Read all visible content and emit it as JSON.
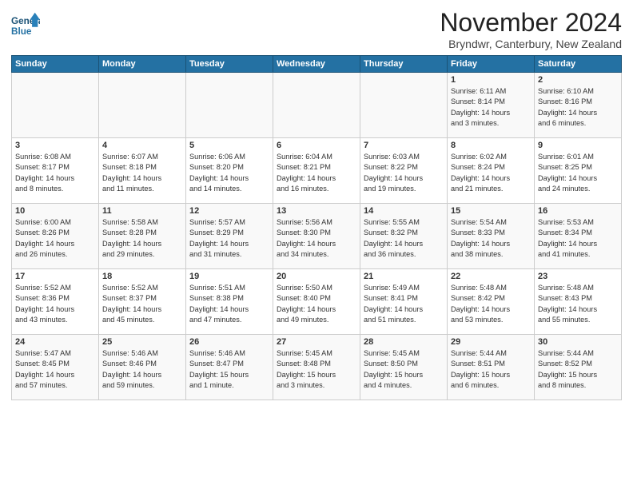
{
  "header": {
    "logo_line1": "General",
    "logo_line2": "Blue",
    "month": "November 2024",
    "location": "Bryndwr, Canterbury, New Zealand"
  },
  "weekdays": [
    "Sunday",
    "Monday",
    "Tuesday",
    "Wednesday",
    "Thursday",
    "Friday",
    "Saturday"
  ],
  "weeks": [
    [
      {
        "day": "",
        "info": ""
      },
      {
        "day": "",
        "info": ""
      },
      {
        "day": "",
        "info": ""
      },
      {
        "day": "",
        "info": ""
      },
      {
        "day": "",
        "info": ""
      },
      {
        "day": "1",
        "info": "Sunrise: 6:11 AM\nSunset: 8:14 PM\nDaylight: 14 hours\nand 3 minutes."
      },
      {
        "day": "2",
        "info": "Sunrise: 6:10 AM\nSunset: 8:16 PM\nDaylight: 14 hours\nand 6 minutes."
      }
    ],
    [
      {
        "day": "3",
        "info": "Sunrise: 6:08 AM\nSunset: 8:17 PM\nDaylight: 14 hours\nand 8 minutes."
      },
      {
        "day": "4",
        "info": "Sunrise: 6:07 AM\nSunset: 8:18 PM\nDaylight: 14 hours\nand 11 minutes."
      },
      {
        "day": "5",
        "info": "Sunrise: 6:06 AM\nSunset: 8:20 PM\nDaylight: 14 hours\nand 14 minutes."
      },
      {
        "day": "6",
        "info": "Sunrise: 6:04 AM\nSunset: 8:21 PM\nDaylight: 14 hours\nand 16 minutes."
      },
      {
        "day": "7",
        "info": "Sunrise: 6:03 AM\nSunset: 8:22 PM\nDaylight: 14 hours\nand 19 minutes."
      },
      {
        "day": "8",
        "info": "Sunrise: 6:02 AM\nSunset: 8:24 PM\nDaylight: 14 hours\nand 21 minutes."
      },
      {
        "day": "9",
        "info": "Sunrise: 6:01 AM\nSunset: 8:25 PM\nDaylight: 14 hours\nand 24 minutes."
      }
    ],
    [
      {
        "day": "10",
        "info": "Sunrise: 6:00 AM\nSunset: 8:26 PM\nDaylight: 14 hours\nand 26 minutes."
      },
      {
        "day": "11",
        "info": "Sunrise: 5:58 AM\nSunset: 8:28 PM\nDaylight: 14 hours\nand 29 minutes."
      },
      {
        "day": "12",
        "info": "Sunrise: 5:57 AM\nSunset: 8:29 PM\nDaylight: 14 hours\nand 31 minutes."
      },
      {
        "day": "13",
        "info": "Sunrise: 5:56 AM\nSunset: 8:30 PM\nDaylight: 14 hours\nand 34 minutes."
      },
      {
        "day": "14",
        "info": "Sunrise: 5:55 AM\nSunset: 8:32 PM\nDaylight: 14 hours\nand 36 minutes."
      },
      {
        "day": "15",
        "info": "Sunrise: 5:54 AM\nSunset: 8:33 PM\nDaylight: 14 hours\nand 38 minutes."
      },
      {
        "day": "16",
        "info": "Sunrise: 5:53 AM\nSunset: 8:34 PM\nDaylight: 14 hours\nand 41 minutes."
      }
    ],
    [
      {
        "day": "17",
        "info": "Sunrise: 5:52 AM\nSunset: 8:36 PM\nDaylight: 14 hours\nand 43 minutes."
      },
      {
        "day": "18",
        "info": "Sunrise: 5:52 AM\nSunset: 8:37 PM\nDaylight: 14 hours\nand 45 minutes."
      },
      {
        "day": "19",
        "info": "Sunrise: 5:51 AM\nSunset: 8:38 PM\nDaylight: 14 hours\nand 47 minutes."
      },
      {
        "day": "20",
        "info": "Sunrise: 5:50 AM\nSunset: 8:40 PM\nDaylight: 14 hours\nand 49 minutes."
      },
      {
        "day": "21",
        "info": "Sunrise: 5:49 AM\nSunset: 8:41 PM\nDaylight: 14 hours\nand 51 minutes."
      },
      {
        "day": "22",
        "info": "Sunrise: 5:48 AM\nSunset: 8:42 PM\nDaylight: 14 hours\nand 53 minutes."
      },
      {
        "day": "23",
        "info": "Sunrise: 5:48 AM\nSunset: 8:43 PM\nDaylight: 14 hours\nand 55 minutes."
      }
    ],
    [
      {
        "day": "24",
        "info": "Sunrise: 5:47 AM\nSunset: 8:45 PM\nDaylight: 14 hours\nand 57 minutes."
      },
      {
        "day": "25",
        "info": "Sunrise: 5:46 AM\nSunset: 8:46 PM\nDaylight: 14 hours\nand 59 minutes."
      },
      {
        "day": "26",
        "info": "Sunrise: 5:46 AM\nSunset: 8:47 PM\nDaylight: 15 hours\nand 1 minute."
      },
      {
        "day": "27",
        "info": "Sunrise: 5:45 AM\nSunset: 8:48 PM\nDaylight: 15 hours\nand 3 minutes."
      },
      {
        "day": "28",
        "info": "Sunrise: 5:45 AM\nSunset: 8:50 PM\nDaylight: 15 hours\nand 4 minutes."
      },
      {
        "day": "29",
        "info": "Sunrise: 5:44 AM\nSunset: 8:51 PM\nDaylight: 15 hours\nand 6 minutes."
      },
      {
        "day": "30",
        "info": "Sunrise: 5:44 AM\nSunset: 8:52 PM\nDaylight: 15 hours\nand 8 minutes."
      }
    ]
  ]
}
